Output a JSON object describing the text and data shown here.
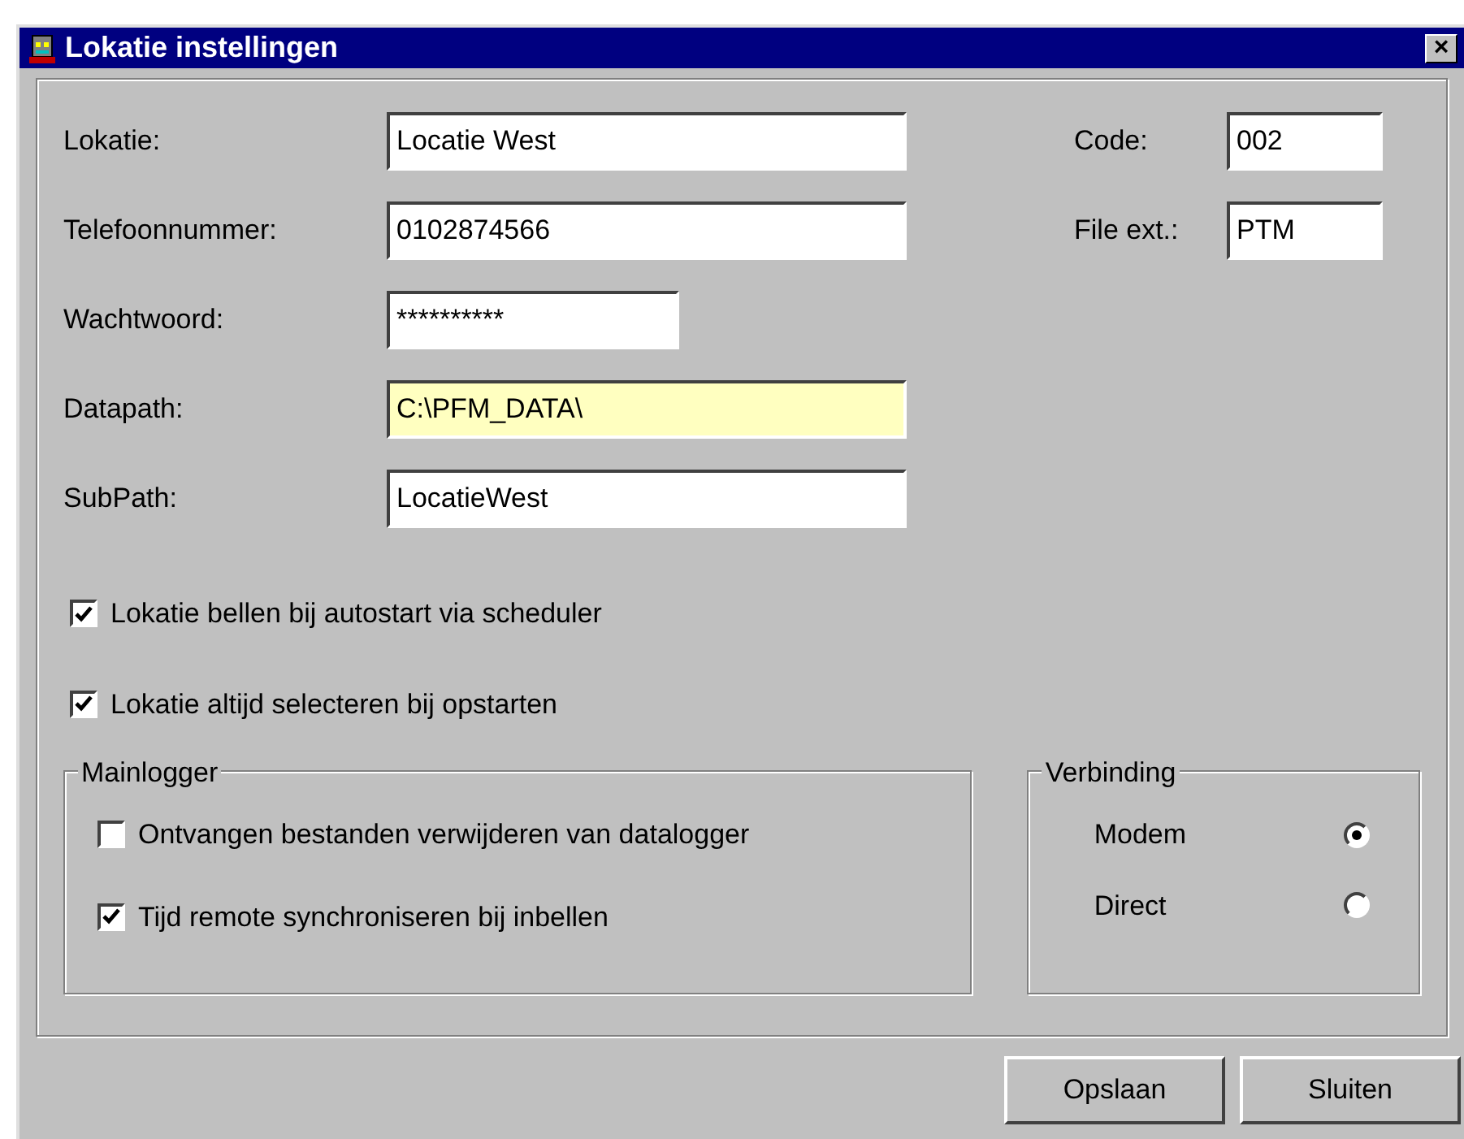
{
  "window": {
    "title": "Lokatie instellingen",
    "close": "×"
  },
  "left_fields": [
    {
      "label": "Lokatie:",
      "value": "Locatie West",
      "kind": "text",
      "highlighted": false
    },
    {
      "label": "Telefoonnummer:",
      "value": "0102874566",
      "kind": "text",
      "highlighted": false
    },
    {
      "label": "Wachtwoord:",
      "value": "**********",
      "kind": "password",
      "highlighted": false
    },
    {
      "label": "Datapath:",
      "value": "C:\\PFM_DATA\\",
      "kind": "text",
      "highlighted": true
    },
    {
      "label": "SubPath:",
      "value": "LocatieWest",
      "kind": "text",
      "highlighted": false
    }
  ],
  "right_fields": [
    {
      "label": "Code:",
      "value": "002"
    },
    {
      "label": "File ext.:",
      "value": "PTM"
    }
  ],
  "options": [
    {
      "label": "Lokatie bellen bij autostart via scheduler",
      "checked": true
    },
    {
      "label": "Lokatie altijd selecteren bij opstarten",
      "checked": true
    }
  ],
  "mainlogger": {
    "title": "Mainlogger",
    "options": [
      {
        "label": "Ontvangen bestanden verwijderen van datalogger",
        "checked": false
      },
      {
        "label": "Tijd remote synchroniseren bij inbellen",
        "checked": true
      }
    ]
  },
  "verbinding": {
    "title": "Verbinding",
    "choices": [
      {
        "label": "Modem",
        "selected": true
      },
      {
        "label": "Direct",
        "selected": false
      }
    ]
  },
  "buttons": [
    "Opslaan",
    "Sluiten"
  ]
}
